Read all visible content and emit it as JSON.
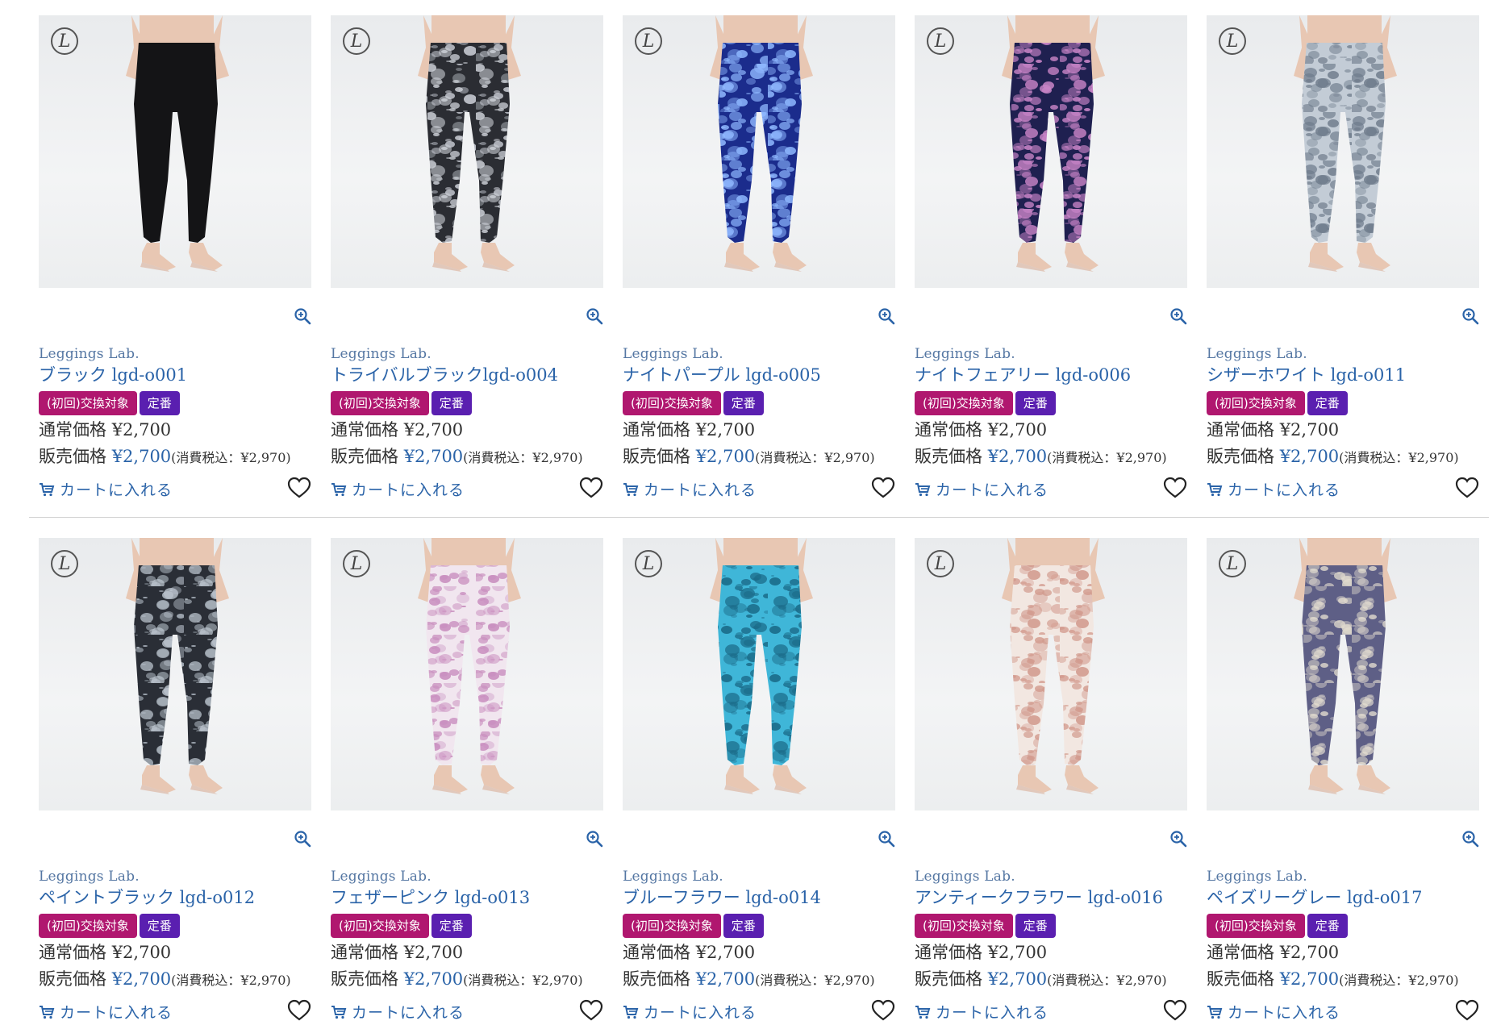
{
  "brand_color": "#2a63a8",
  "badge_colors": {
    "exchange": "#b0176f",
    "standard": "#5a1fb0"
  },
  "icons": {
    "zoom": "zoom-in-icon",
    "cart": "cart-icon",
    "favorite": "heart-icon",
    "logo": "brand-logo-icon"
  },
  "logo_letter": "L",
  "products": [
    {
      "brand": "Leggings Lab.",
      "name": "ブラック lgd-o001",
      "badge_exchange": "(初回)交換対象",
      "badge_standard": "定番",
      "regular_label": "通常価格",
      "regular_price": "¥2,700",
      "sale_label": "販売価格",
      "sale_price": "¥2,700",
      "tax_note": "(消費税込：¥2,970)",
      "cart_label": "カートに入れる",
      "pattern": "black",
      "base": "#141416",
      "accent": "#2a2a2e"
    },
    {
      "brand": "Leggings Lab.",
      "name": "トライバルブラックlgd-o004",
      "badge_exchange": "(初回)交換対象",
      "badge_standard": "定番",
      "regular_label": "通常価格",
      "regular_price": "¥2,700",
      "sale_label": "販売価格",
      "sale_price": "¥2,700",
      "tax_note": "(消費税込：¥2,970)",
      "cart_label": "カートに入れる",
      "pattern": "tribal",
      "base": "#2b2d33",
      "accent": "#c9cdd4"
    },
    {
      "brand": "Leggings Lab.",
      "name": "ナイトパープル lgd-o005",
      "badge_exchange": "(初回)交換対象",
      "badge_standard": "定番",
      "regular_label": "通常価格",
      "regular_price": "¥2,700",
      "sale_label": "販売価格",
      "sale_price": "¥2,700",
      "tax_note": "(消費税込：¥2,970)",
      "cart_label": "カートに入れる",
      "pattern": "galaxy",
      "base": "#1b2c8c",
      "accent": "#8fb8ff"
    },
    {
      "brand": "Leggings Lab.",
      "name": "ナイトフェアリー lgd-o006",
      "badge_exchange": "(初回)交換対象",
      "badge_standard": "定番",
      "regular_label": "通常価格",
      "regular_price": "¥2,700",
      "sale_label": "販売価格",
      "sale_price": "¥2,700",
      "tax_note": "(消費税込：¥2,970)",
      "cart_label": "カートに入れる",
      "pattern": "fairy",
      "base": "#1f2050",
      "accent": "#c783c6"
    },
    {
      "brand": "Leggings Lab.",
      "name": "シザーホワイト lgd-o011",
      "badge_exchange": "(初回)交換対象",
      "badge_standard": "定番",
      "regular_label": "通常価格",
      "regular_price": "¥2,700",
      "sale_label": "販売価格",
      "sale_price": "¥2,700",
      "tax_note": "(消費税込：¥2,970)",
      "cart_label": "カートに入れる",
      "pattern": "white",
      "base": "#c3ccd6",
      "accent": "#6f7c8c"
    },
    {
      "brand": "Leggings Lab.",
      "name": "ペイントブラック lgd-o012",
      "badge_exchange": "(初回)交換対象",
      "badge_standard": "定番",
      "regular_label": "通常価格",
      "regular_price": "¥2,700",
      "sale_label": "販売価格",
      "sale_price": "¥2,700",
      "tax_note": "(消費税込：¥2,970)",
      "cart_label": "カートに入れる",
      "pattern": "paint",
      "base": "#2a2e36",
      "accent": "#b9c2cc"
    },
    {
      "brand": "Leggings Lab.",
      "name": "フェザーピンク lgd-o013",
      "badge_exchange": "(初回)交換対象",
      "badge_standard": "定番",
      "regular_label": "通常価格",
      "regular_price": "¥2,700",
      "sale_label": "販売価格",
      "sale_price": "¥2,700",
      "tax_note": "(消費税込：¥2,970)",
      "cart_label": "カートに入れる",
      "pattern": "feather",
      "base": "#f1e6ef",
      "accent": "#c98fbf"
    },
    {
      "brand": "Leggings Lab.",
      "name": "ブルーフラワー lgd-o014",
      "badge_exchange": "(初回)交換対象",
      "badge_standard": "定番",
      "regular_label": "通常価格",
      "regular_price": "¥2,700",
      "sale_label": "販売価格",
      "sale_price": "¥2,700",
      "tax_note": "(消費税込：¥2,970)",
      "cart_label": "カートに入れる",
      "pattern": "blueflower",
      "base": "#3fb6d8",
      "accent": "#1b6c8a"
    },
    {
      "brand": "Leggings Lab.",
      "name": "アンティークフラワー lgd-o016",
      "badge_exchange": "(初回)交換対象",
      "badge_standard": "定番",
      "regular_label": "通常価格",
      "regular_price": "¥2,700",
      "sale_label": "販売価格",
      "sale_price": "¥2,700",
      "tax_note": "(消費税込：¥2,970)",
      "cart_label": "カートに入れる",
      "pattern": "antique",
      "base": "#f2e7e1",
      "accent": "#d29b8e"
    },
    {
      "brand": "Leggings Lab.",
      "name": "ペイズリーグレー lgd-o017",
      "badge_exchange": "(初回)交換対象",
      "badge_standard": "定番",
      "regular_label": "通常価格",
      "regular_price": "¥2,700",
      "sale_label": "販売価格",
      "sale_price": "¥2,700",
      "tax_note": "(消費税込：¥2,970)",
      "cart_label": "カートに入れる",
      "pattern": "paisley",
      "base": "#5e5f86",
      "accent": "#e2dccf"
    }
  ]
}
